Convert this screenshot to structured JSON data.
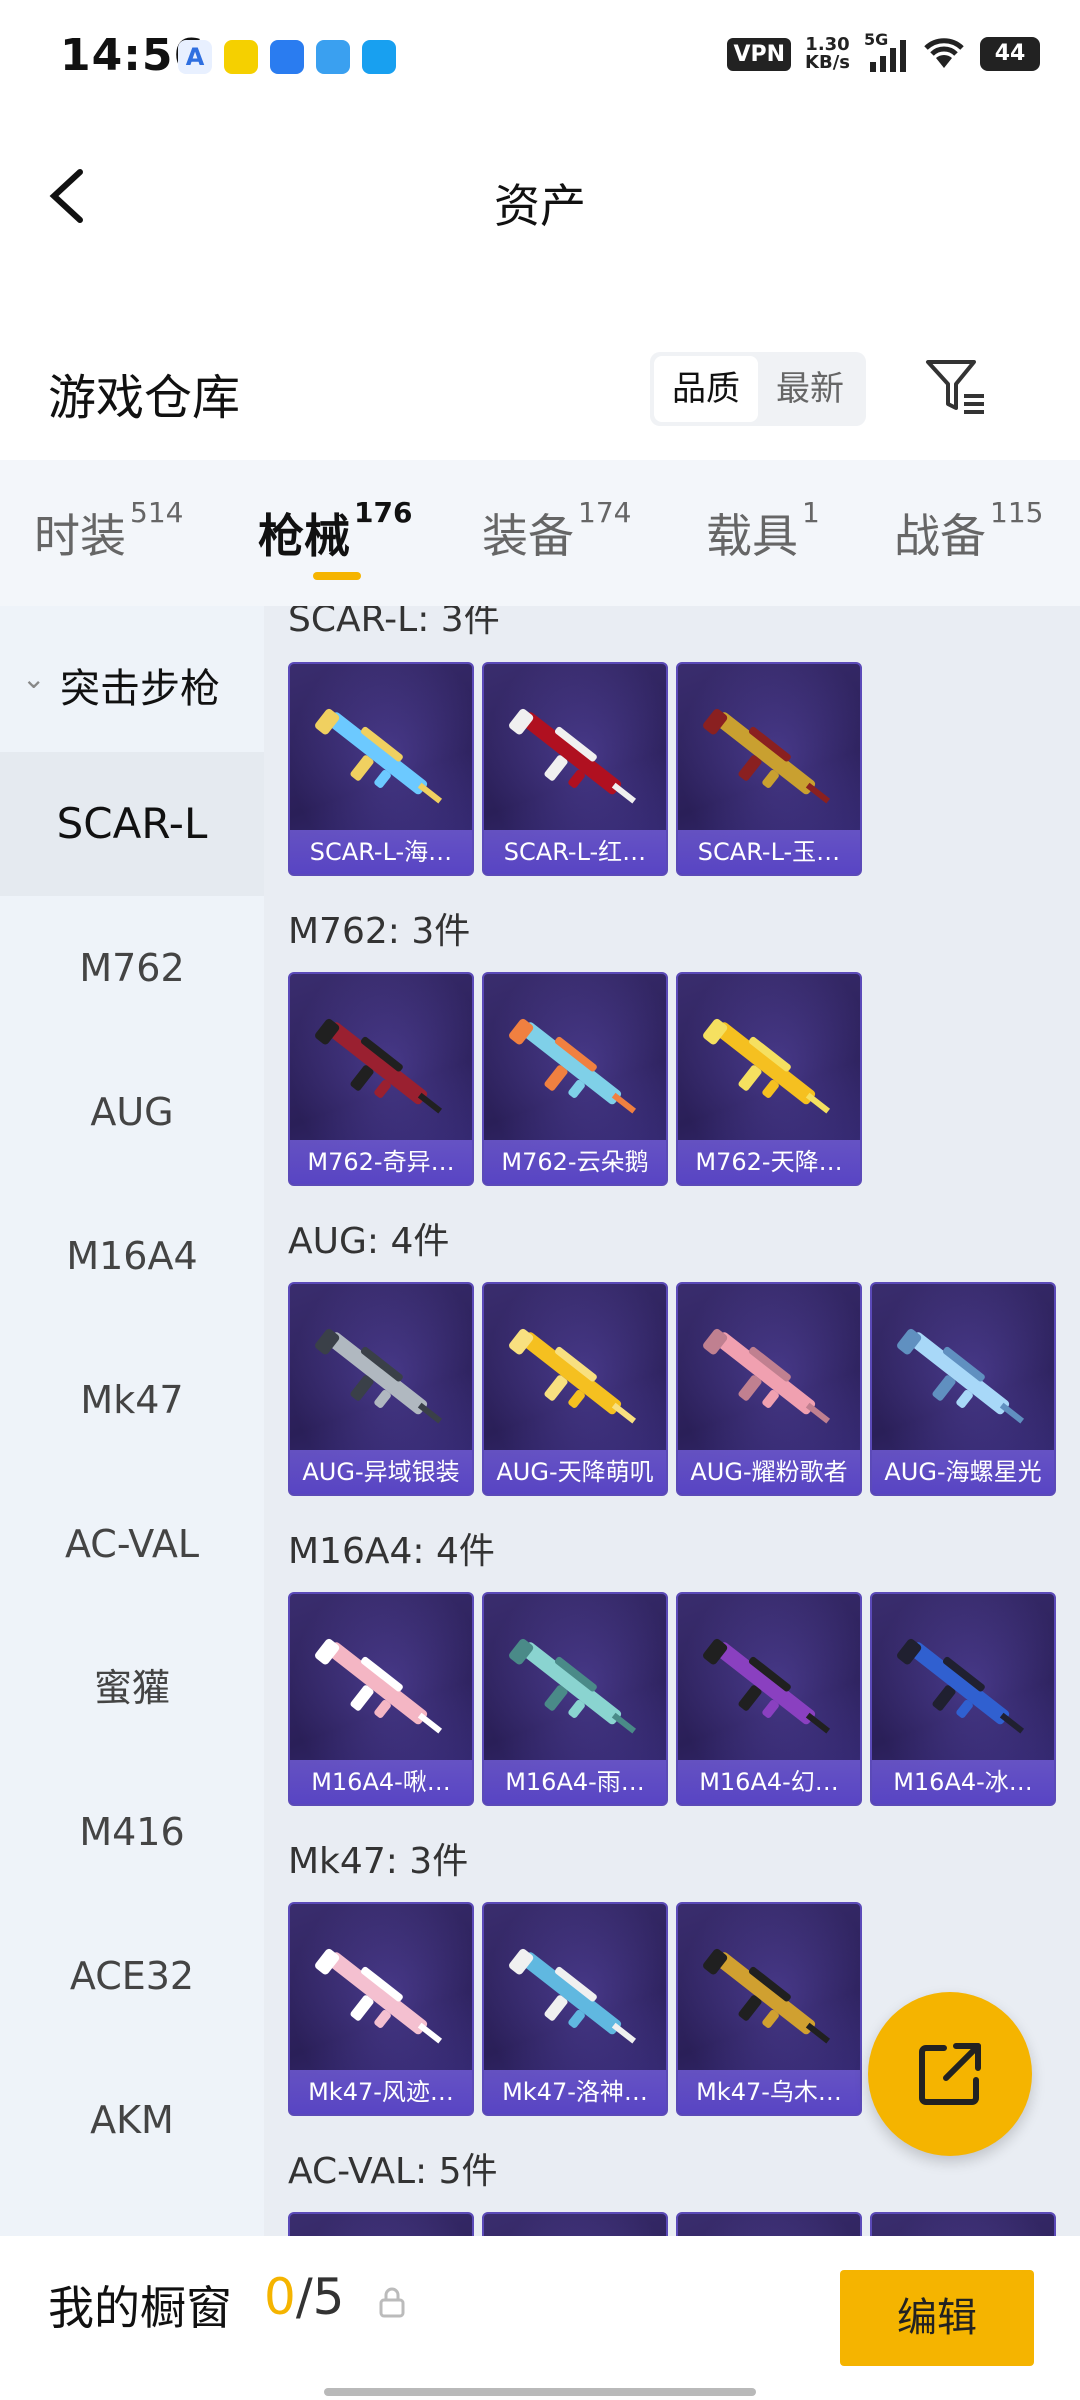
{
  "status_bar": {
    "time": "14:56",
    "vpn": "VPN",
    "net_speed_value": "1.30",
    "net_speed_unit": "KB/s",
    "signal_type": "5G",
    "battery": "44"
  },
  "header": {
    "title": "资产"
  },
  "warehouse": {
    "title": "游戏仓库",
    "sort_options": [
      "品质",
      "最新"
    ],
    "sort_selected": "品质"
  },
  "tabs": [
    {
      "label": "时装",
      "count": "514"
    },
    {
      "label": "枪械",
      "count": "176",
      "active": true
    },
    {
      "label": "装备",
      "count": "174"
    },
    {
      "label": "载具",
      "count": "1"
    },
    {
      "label": "战备",
      "count": "115"
    }
  ],
  "left_nav": {
    "group": "突击步枪",
    "items": [
      "SCAR-L",
      "M762",
      "AUG",
      "M16A4",
      "Mk47",
      "AC-VAL",
      "蜜獾",
      "M416",
      "ACE32",
      "AKM"
    ],
    "selected": "SCAR-L"
  },
  "sections": [
    {
      "header": "SCAR-L: 3件",
      "items": [
        "SCAR-L-海…",
        "SCAR-L-红…",
        "SCAR-L-玉…"
      ]
    },
    {
      "header": "M762: 3件",
      "items": [
        "M762-奇异…",
        "M762-云朵鹅",
        "M762-天降…"
      ]
    },
    {
      "header": "AUG: 4件",
      "items": [
        "AUG-异域银装",
        "AUG-天降萌叽",
        "AUG-耀粉歌者",
        "AUG-海螺星光"
      ]
    },
    {
      "header": "M16A4: 4件",
      "items": [
        "M16A4-啾…",
        "M16A4-雨…",
        "M16A4-幻…",
        "M16A4-冰…"
      ]
    },
    {
      "header": "Mk47: 3件",
      "items": [
        "Mk47-风迹…",
        "Mk47-洛神…",
        "Mk47-乌木…"
      ]
    },
    {
      "header": "AC-VAL: 5件",
      "items": []
    }
  ],
  "bottom_bar": {
    "label": "我的橱窗",
    "current": "0",
    "total": "/5",
    "edit_label": "编辑"
  },
  "colors": {
    "accent": "#f5b400",
    "card_bg": "#2a1f58",
    "card_caption": "#6a55d0"
  },
  "gun_colors": [
    [
      "#6cc9ff",
      "#f0d060"
    ],
    [
      "#b01020",
      "#f0f0f0"
    ],
    [
      "#c9a030",
      "#8a2020"
    ],
    [
      "#9a2030",
      "#202020"
    ],
    [
      "#7fd0e8",
      "#f08040"
    ],
    [
      "#f5c020",
      "#f5e060"
    ],
    [
      "#b0b8c0",
      "#3a4048"
    ],
    [
      "#f5c020",
      "#f8e080"
    ],
    [
      "#f0a0b0",
      "#c08090"
    ],
    [
      "#a8d8f8",
      "#6090c0"
    ],
    [
      "#f4b6c4",
      "#ffffff"
    ],
    [
      "#8ad4d0",
      "#4a8a88"
    ],
    [
      "#8a40c0",
      "#202020"
    ],
    [
      "#3060d0",
      "#202030"
    ],
    [
      "#f4c0d0",
      "#ffffff"
    ],
    [
      "#60b8e0",
      "#f0f0f0"
    ],
    [
      "#d0a030",
      "#202020"
    ]
  ]
}
